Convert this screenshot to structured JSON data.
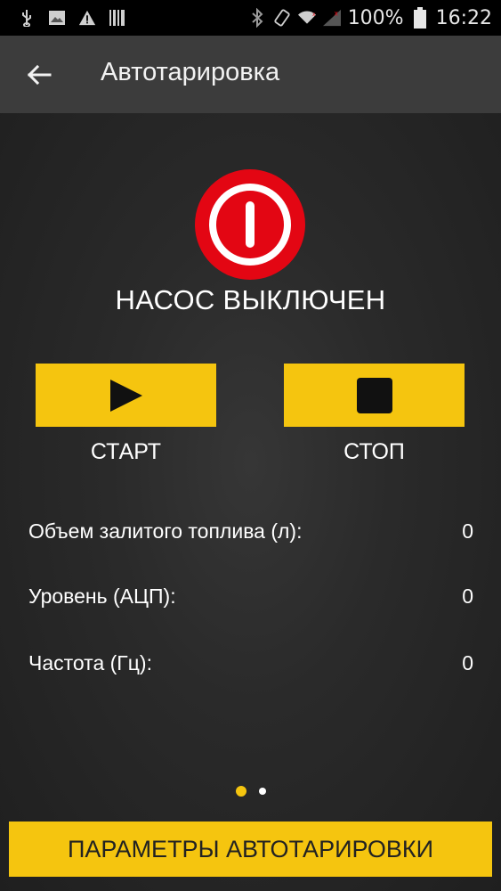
{
  "status_bar": {
    "battery": "100%",
    "time": "16:22",
    "icons": [
      "usb-icon",
      "image-icon",
      "warning-icon",
      "barcode-icon",
      "bluetooth-icon",
      "rotate-icon",
      "wifi-icon",
      "signal-icon",
      "battery-icon"
    ]
  },
  "toolbar": {
    "title": "Автотарировка",
    "back_icon": "arrow-left-icon"
  },
  "pump": {
    "status": "НАСОС ВЫКЛЮЧЕН",
    "status_color": "#e30613",
    "icon": "power-icon"
  },
  "controls": {
    "start_label": "СТАРТ",
    "stop_label": "СТОП",
    "start_icon": "play-icon",
    "stop_icon": "stop-icon",
    "button_color": "#f5c50f"
  },
  "readings": [
    {
      "label": "Объем залитого топлива (л):",
      "value": "0"
    },
    {
      "label": "Уровень (АЦП):",
      "value": "0"
    },
    {
      "label": "Частота (Гц):",
      "value": "0"
    }
  ],
  "pager": {
    "pages": 2,
    "current": 1
  },
  "bottom": {
    "label": "ПАРАМЕТРЫ АВТОТАРИРОВКИ"
  },
  "colors": {
    "accent": "#f5c50f",
    "toolbar_bg": "#3c3c3c",
    "status_bar_bg": "#000000"
  }
}
